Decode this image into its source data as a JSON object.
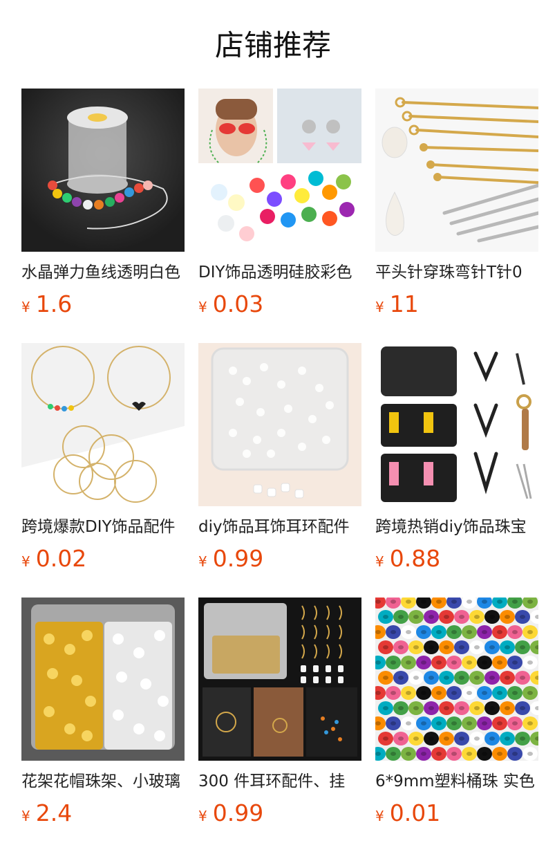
{
  "page": {
    "title": "店铺推荐"
  },
  "colors": {
    "price": "#e8480c",
    "title": "#111111",
    "text": "#222222"
  },
  "products": [
    {
      "name": "水晶弹力鱼线透明白色",
      "currency": "¥",
      "price": "1.6",
      "image": "elastic-thread-spool-with-beads"
    },
    {
      "name": "DIY饰品透明硅胶彩色",
      "currency": "¥",
      "price": "0.03",
      "image": "colorful-silicone-glasses-chain-ends"
    },
    {
      "name": "平头针穿珠弯针T针0",
      "currency": "¥",
      "price": "11",
      "image": "gold-head-pins-with-pearls"
    },
    {
      "name": "跨境爆款DIY饰品配件",
      "currency": "¥",
      "price": "0.02",
      "image": "gold-hoop-earring-wires"
    },
    {
      "name": "diy饰品耳饰耳环配件",
      "currency": "¥",
      "price": "0.99",
      "image": "clear-earring-backs-in-box"
    },
    {
      "name": "跨境热销diy饰品珠宝",
      "currency": "¥",
      "price": "0.88",
      "image": "jewelry-pliers-tool-kit"
    },
    {
      "name": "花架花帽珠架、小玻璃",
      "currency": "¥",
      "price": "2.4",
      "image": "gold-silver-bead-caps-box"
    },
    {
      "name": "300 件耳环配件、挂",
      "currency": "¥",
      "price": "0.99",
      "image": "earring-making-kit"
    },
    {
      "name": "6*9mm塑料桶珠 实色",
      "currency": "¥",
      "price": "0.01",
      "image": "colorful-pony-beads"
    }
  ]
}
